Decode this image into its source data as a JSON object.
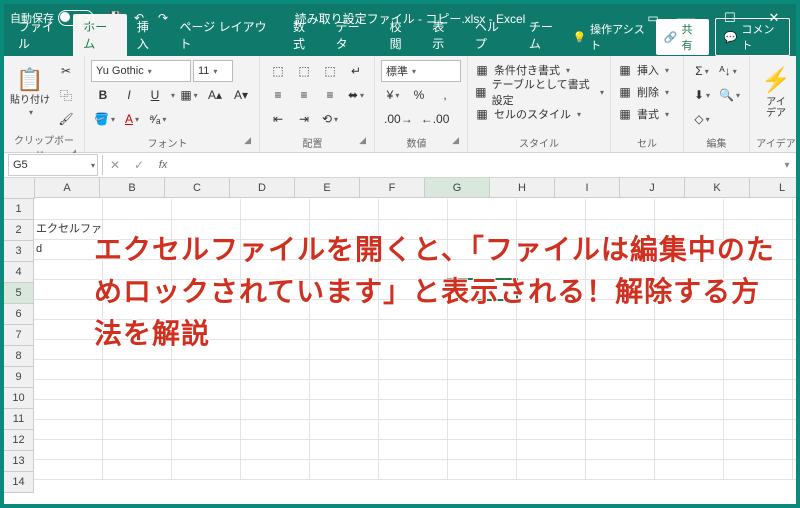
{
  "titlebar": {
    "autosave_label": "自動保存",
    "autosave_off": "オフ",
    "document": "読み取り設定ファイル - コピー.xlsx  -  Excel"
  },
  "tabs": {
    "file": "ファイル",
    "home": "ホーム",
    "insert": "挿入",
    "pagelayout": "ページ レイアウト",
    "formulas": "数式",
    "data": "データ",
    "review": "校閲",
    "view": "表示",
    "help": "ヘルプ",
    "team": "チーム",
    "tell": "操作アシスト",
    "share": "共有",
    "comment": "コメント"
  },
  "ribbon": {
    "clipboard": {
      "paste": "貼り付け",
      "label": "クリップボード"
    },
    "font": {
      "name": "Yu Gothic",
      "size": "11",
      "bold": "B",
      "italic": "I",
      "underline": "U",
      "label": "フォント"
    },
    "align": {
      "label": "配置"
    },
    "number": {
      "format": "標準",
      "label": "数値"
    },
    "styles": {
      "cond": "条件付き書式",
      "table": "テーブルとして書式設定",
      "cell": "セルのスタイル",
      "label": "スタイル"
    },
    "cells": {
      "insert": "挿入",
      "delete": "削除",
      "format": "書式",
      "label": "セル"
    },
    "editing": {
      "label": "編集"
    },
    "ideas": {
      "btn": "アイ\nデア",
      "label": "アイデア"
    }
  },
  "fbar": {
    "name": "G5",
    "fx": "fx"
  },
  "cols": [
    "A",
    "B",
    "C",
    "D",
    "E",
    "F",
    "G",
    "H",
    "I",
    "J",
    "K",
    "L"
  ],
  "rows": [
    "1",
    "2",
    "3",
    "4",
    "5",
    "6",
    "7",
    "8",
    "9",
    "10",
    "11",
    "12",
    "13",
    "14"
  ],
  "cells": {
    "A2": "エクセルファイル",
    "A3": "d"
  },
  "active": {
    "col": 6,
    "row": 4
  },
  "overlay": "エクセルファイルを開くと、「ファイルは編集中のためロックされています」と表示される！解除する方法を解説"
}
